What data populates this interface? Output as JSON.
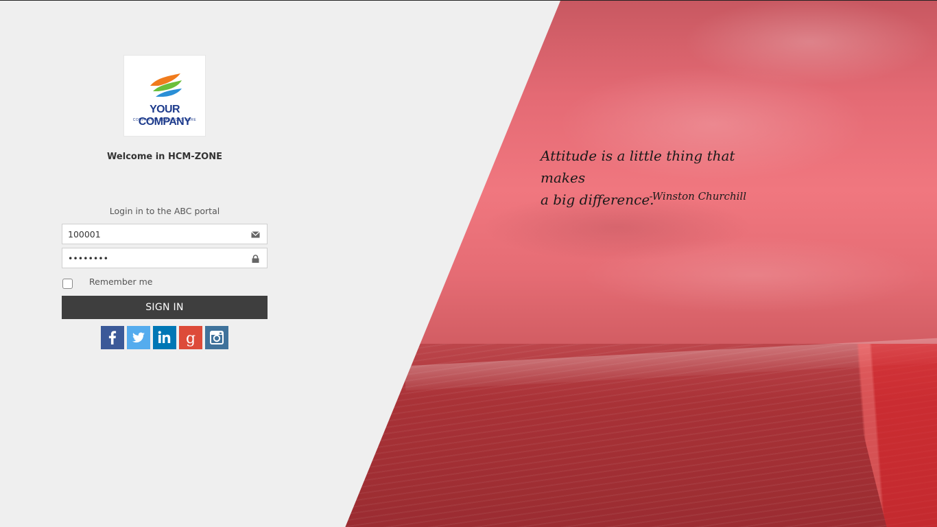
{
  "brand": {
    "logo_text": "YOUR COMPANY",
    "logo_slogan": "COMPANY SLOGAN GOES HERE"
  },
  "welcome": "Welcome in HCM-ZONE",
  "login": {
    "subtitle": "Login in to the ABC portal",
    "username_value": "100001",
    "password_value": "••••••••",
    "remember_label": "Remember me",
    "remember_checked": false,
    "signin_label": "SIGN IN"
  },
  "social": [
    {
      "name": "facebook-icon",
      "color": "#3b5998"
    },
    {
      "name": "twitter-icon",
      "color": "#55acee"
    },
    {
      "name": "linkedin-icon",
      "color": "#0077b5"
    },
    {
      "name": "google-plus-icon",
      "color": "#dd4b39"
    },
    {
      "name": "instagram-icon",
      "color": "#3f729b"
    }
  ],
  "quote": {
    "line1": "Attitude is a little thing that makes",
    "line2": "a big difference.",
    "author": "-Winston Churchill"
  },
  "colors": {
    "accent_overlay": "#e8636d",
    "button": "#3e3e3e",
    "background": "#efefef"
  }
}
